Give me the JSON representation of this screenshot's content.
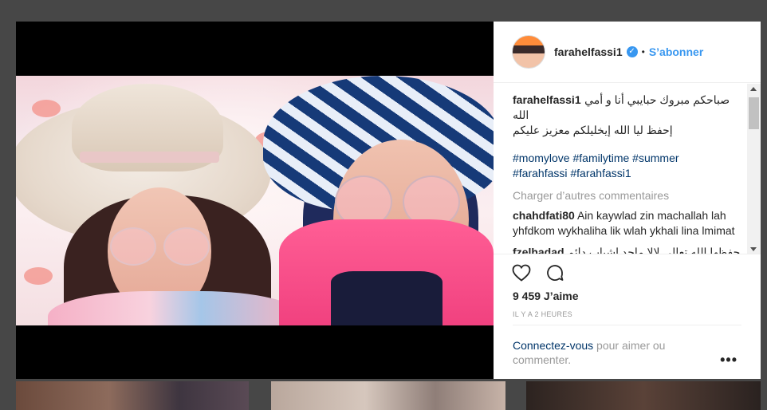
{
  "post": {
    "username": "farahelfassi1",
    "follow_label": "S’abonner",
    "caption_user": "farahelfassi1",
    "caption_text_line1": "صباحكم مبروك حبايبي أنا و أمي الله",
    "caption_text_line2": "إحفظ ليا الله إيخليلكم معزيز عليكم",
    "hashtags": [
      "#momylove",
      "#familytime",
      "#summer",
      "#farahfassi",
      "#farahfassi1"
    ],
    "load_more_label": "Charger d’autres commentaires",
    "comments": [
      {
        "user": "chahdfati80",
        "text": "Ain kaywlad zin machallah lah yhfdkom wykhaliha lik wlah ykhali lina lmimat"
      },
      {
        "user": "fzelhadad",
        "text": "حفظها الله تعالى لالا ماجد اشباب دائم 😍😍"
      }
    ],
    "likes": "9 459 J’aime",
    "time_ago": "IL Y A 2 HEURES",
    "login_link": "Connectez-vous",
    "login_text": " pour aimer ou commenter.",
    "more_label": "•••"
  },
  "icons": {
    "verified": "verified-badge-icon",
    "like": "heart-icon",
    "comment": "comment-bubble-icon",
    "more": "more-options-icon"
  },
  "colors": {
    "link_blue": "#3897f0",
    "hashtag_blue": "#003569",
    "text": "#262626",
    "muted": "#999999",
    "overlay_bg": "#474747"
  }
}
